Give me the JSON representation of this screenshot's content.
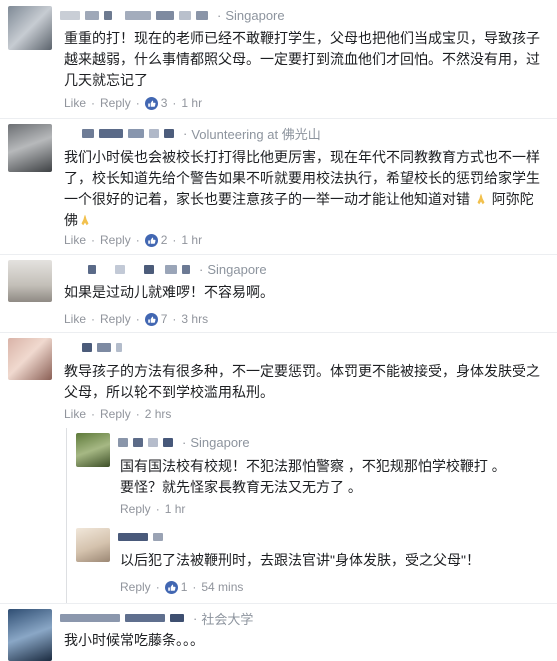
{
  "comments": [
    {
      "location": "Singapore",
      "lines": [
        "重重的打！现在的老师已经不敢鞭打学生，父母也把他们当成宝贝，导致孩子",
        "越来越弱，什么事情都照父母。一定要打到流血他们才回怕。不然没有用，过",
        "几天就忘记了"
      ],
      "like": "Like",
      "reply": "Reply",
      "reactions": "3",
      "time": "1 hr"
    },
    {
      "location": "Volunteering at 佛光山",
      "lines": [
        "我们小时侯也会被校长打打得比他更厉害，现在年代不同教教育方式也不一样",
        "了，校长知道先给个警告如果不听就要用校法执行，希望校长的惩罚给家学生",
        "一个很好的记着，家长也要注意孩子的一举一动才能让他知道对错",
        "佛"
      ],
      "line3_suffix": "阿弥陀",
      "like": "Like",
      "reply": "Reply",
      "reactions": "2",
      "time": "1 hr"
    },
    {
      "location": "Singapore",
      "lines": [
        "如果是过动儿就难啰！不容易啊。"
      ],
      "like": "Like",
      "reply": "Reply",
      "reactions": "7",
      "time": "3 hrs"
    },
    {
      "location": "",
      "lines": [
        "教导孩子的方法有很多种，不一定要惩罚。体罚更不能被接受，身体发肤受之",
        "父母，所以轮不到学校滥用私刑。"
      ],
      "like": "Like",
      "reply": "Reply",
      "time": "2 hrs"
    },
    {
      "location": "Singapore",
      "lines": [
        "国有国法校有校规！不犯法那怕警察 ，不犯规那怕学校鞭打 。",
        "要怪？就先怪家長教育无法又无方了 。"
      ],
      "reply": "Reply",
      "time": "1 hr"
    },
    {
      "location": "",
      "lines": [
        "以后犯了法被鞭刑时，去跟法官讲\"身体发肤，受之父母\"！"
      ],
      "reply": "Reply",
      "reactions": "1",
      "time": "54 mins"
    },
    {
      "location": "社会大学",
      "lines": [
        "我小时候常吃藤条。。。"
      ]
    }
  ],
  "colors": {
    "like_blue": "#4267b2",
    "name_blue": "#365899",
    "meta_gray": "#90949c"
  }
}
